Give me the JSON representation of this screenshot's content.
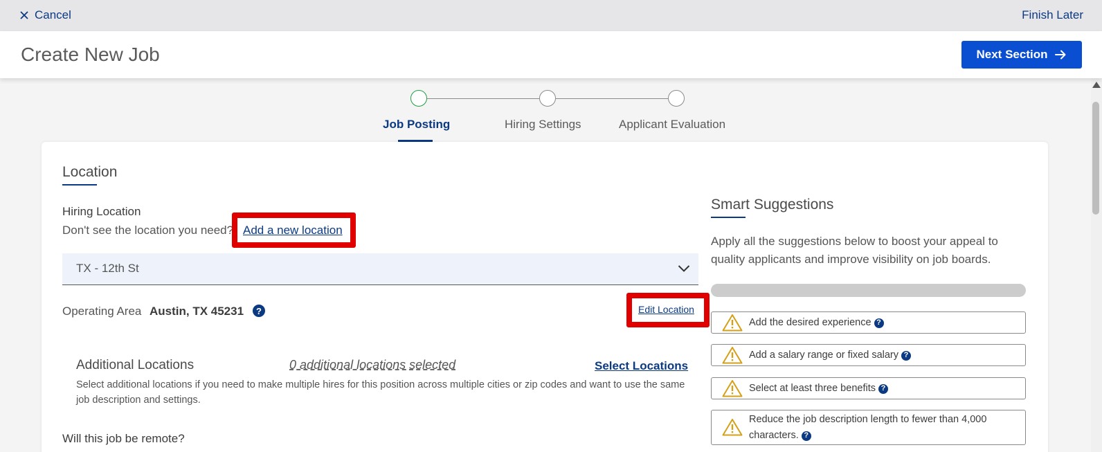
{
  "topbar": {
    "cancel_label": "Cancel",
    "finish_later_label": "Finish Later"
  },
  "header": {
    "title": "Create New Job",
    "next_label": "Next Section"
  },
  "stepper": {
    "steps": [
      {
        "label": "Job Posting",
        "state": "active"
      },
      {
        "label": "Hiring Settings",
        "state": "pending"
      },
      {
        "label": "Applicant Evaluation",
        "state": "pending"
      }
    ]
  },
  "location": {
    "title": "Location",
    "hiring_label": "Hiring Location",
    "dont_see": "Don't see the location you need?",
    "add_new_link": "Add a new location",
    "selected_location": "TX - 12th St",
    "operating_area_label": "Operating Area",
    "operating_area_value": "Austin, TX 45231",
    "edit_link": "Edit Location",
    "additional": {
      "title": "Additional Locations",
      "count_text": "0 additional locations selected",
      "select_link": "Select Locations",
      "description": "Select additional locations if you need to make multiple hires for this position across multiple cities or zip codes and want to use the same job description and settings."
    },
    "remote_question": "Will this job be remote?"
  },
  "smart_suggestions": {
    "title": "Smart Suggestions",
    "description": "Apply all the suggestions below to boost your appeal to quality applicants and improve visibility on job boards.",
    "progress": 0,
    "items": [
      "Add the desired experience",
      "Add a salary range or fixed salary",
      "Select at least three benefits",
      "Reduce the job description length to fewer than 4,000 characters."
    ]
  },
  "colors": {
    "primary": "#0a4fd1",
    "link": "#0b3a82",
    "active_step": "#1e9e3e",
    "highlight": "#e10000",
    "warning": "#d4a017"
  },
  "icons": {
    "cancel": "close-icon",
    "next": "arrow-right-icon",
    "dropdown": "chevron-down-icon",
    "help": "question-circle-icon",
    "warning": "warning-triangle-icon"
  }
}
